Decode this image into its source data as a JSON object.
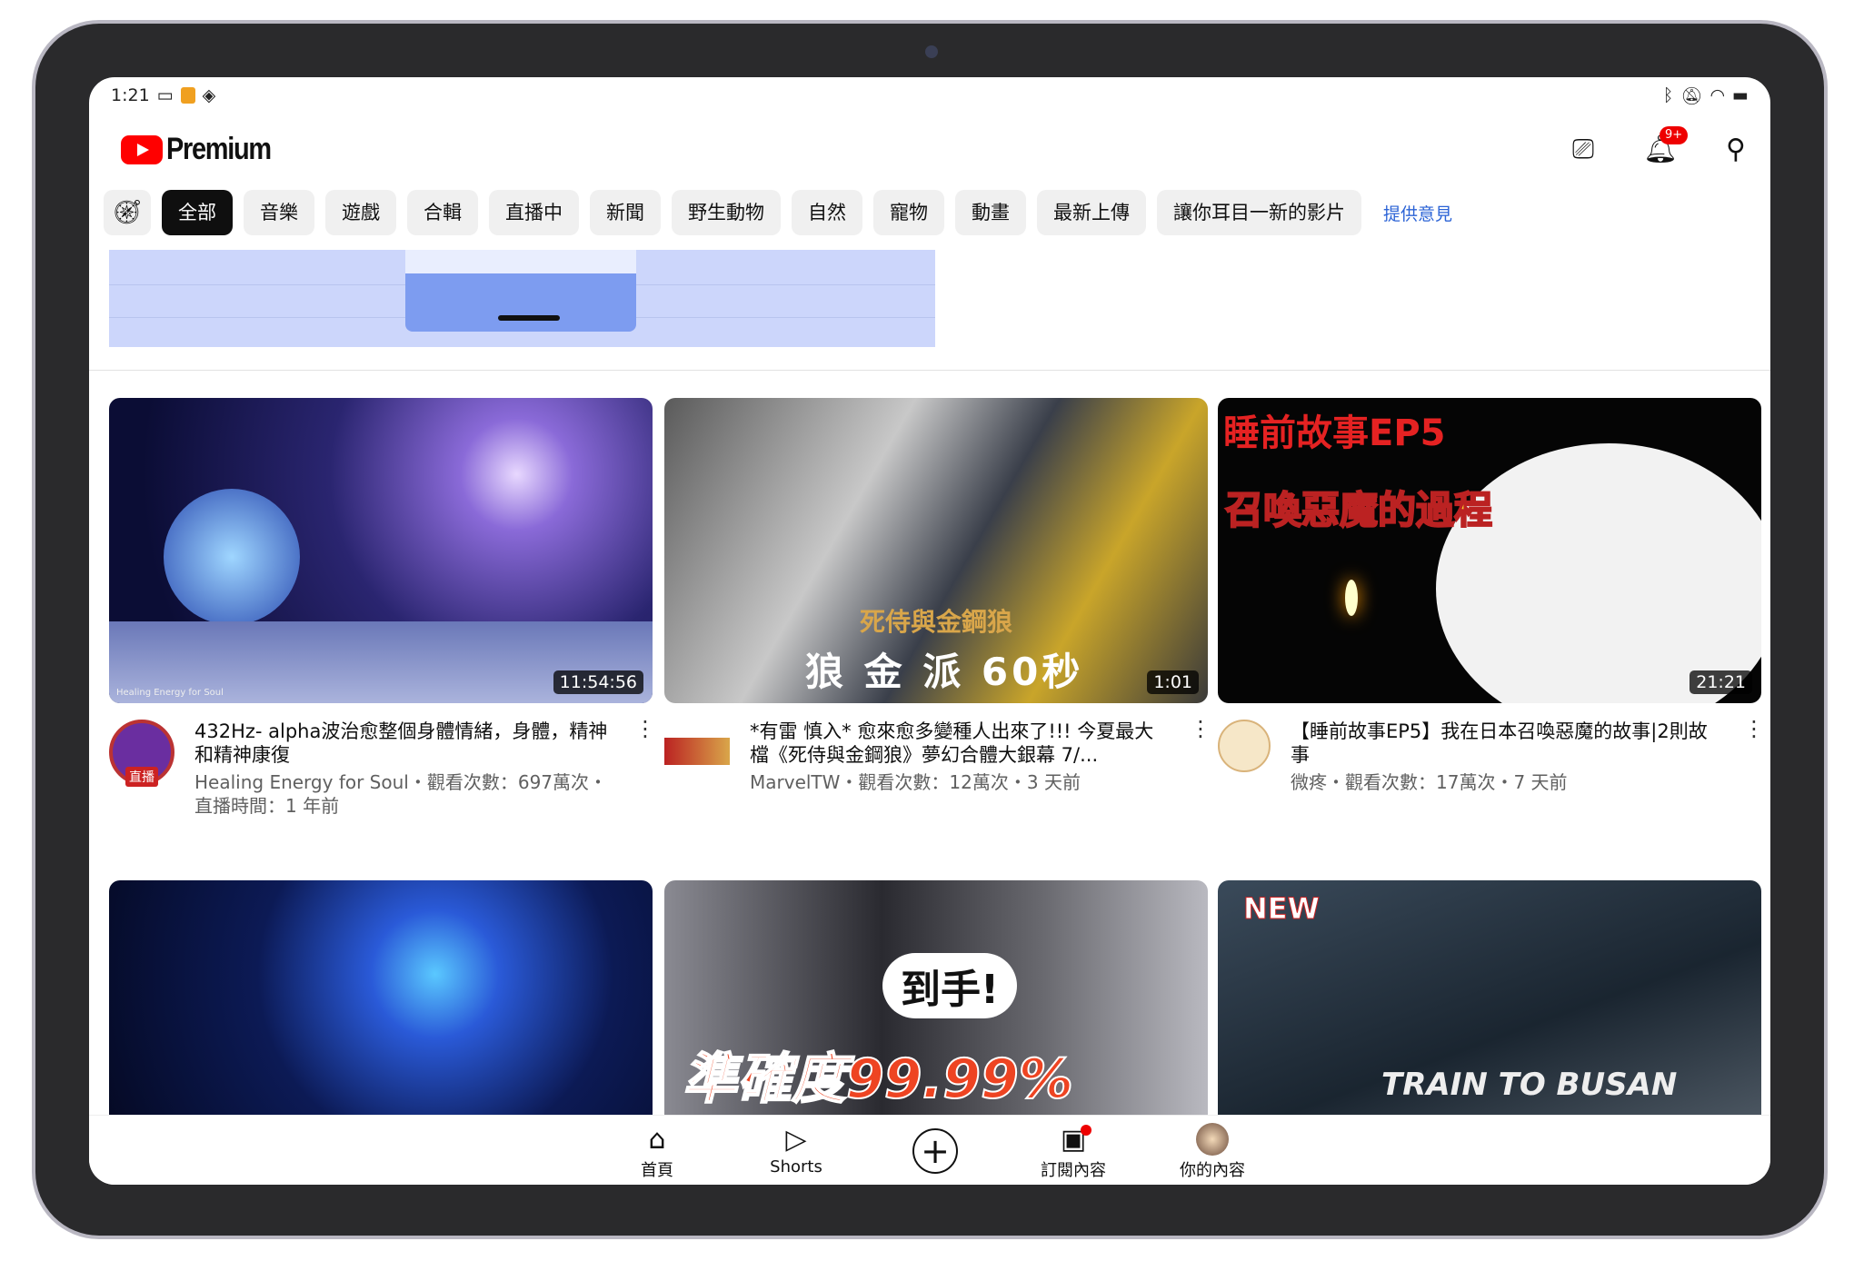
{
  "status": {
    "time": "1:21",
    "right_icons": [
      "bluetooth-icon",
      "mute-icon",
      "wifi-icon",
      "battery-icon"
    ]
  },
  "header": {
    "brand": "Premium",
    "notification_count": "9+",
    "icons": [
      "cast-icon",
      "bell-icon",
      "search-icon"
    ]
  },
  "chips": [
    {
      "label": "全部",
      "active": true
    },
    {
      "label": "音樂"
    },
    {
      "label": "遊戲"
    },
    {
      "label": "合輯"
    },
    {
      "label": "直播中"
    },
    {
      "label": "新聞"
    },
    {
      "label": "野生動物"
    },
    {
      "label": "自然"
    },
    {
      "label": "寵物"
    },
    {
      "label": "動畫"
    },
    {
      "label": "最新上傳"
    },
    {
      "label": "讓你耳目一新的影片"
    }
  ],
  "feedback": "提供意見",
  "videos": [
    {
      "title": "432Hz- alpha波治愈整個身體情緒，身體，精神和精神康復",
      "channel_line": "Healing Energy for Soul・觀看次數：697萬次・直播時間：1 年前",
      "duration": "11:54:56",
      "live_badge": "直播",
      "thumb_text": "Healing Energy for Soul"
    },
    {
      "title": "*有雷 慎入* 愈來愈多變種人出來了!!! 今夏最大檔《死侍與金鋼狼》夢幻合體大銀幕 7/...",
      "channel_line": "MarvelTW・觀看次數：12萬次・3 天前",
      "duration": "1:01",
      "thumb_text": "死侍與金鋼狼",
      "thumb_text2": "狼 金 派  60秒"
    },
    {
      "title": "【睡前故事EP5】我在日本召喚惡魔的故事|2則故事",
      "channel_line": "微疼・觀看次數：17萬次・7 天前",
      "duration": "21:21",
      "thumb_text": "睡前故事EP5",
      "thumb_text2": "召喚惡魔的過程"
    }
  ],
  "row2": [
    {
      "thumb_text": ""
    },
    {
      "thumb_text": "準確度99.99%",
      "thumb_text2": "到手!"
    },
    {
      "thumb_text": "TRAIN TO BUSAN",
      "thumb_text2": "NEW"
    }
  ],
  "nav": [
    {
      "label": "首頁",
      "icon": "home-icon"
    },
    {
      "label": "Shorts",
      "icon": "shorts-icon"
    },
    {
      "label": "",
      "icon": "create-icon"
    },
    {
      "label": "訂閱內容",
      "icon": "subscriptions-icon"
    },
    {
      "label": "你的內容",
      "icon": "avatar"
    }
  ],
  "colors": {
    "brand": "#ff0000",
    "link": "#2b63d6",
    "chip_active": "#0f0f0f"
  }
}
